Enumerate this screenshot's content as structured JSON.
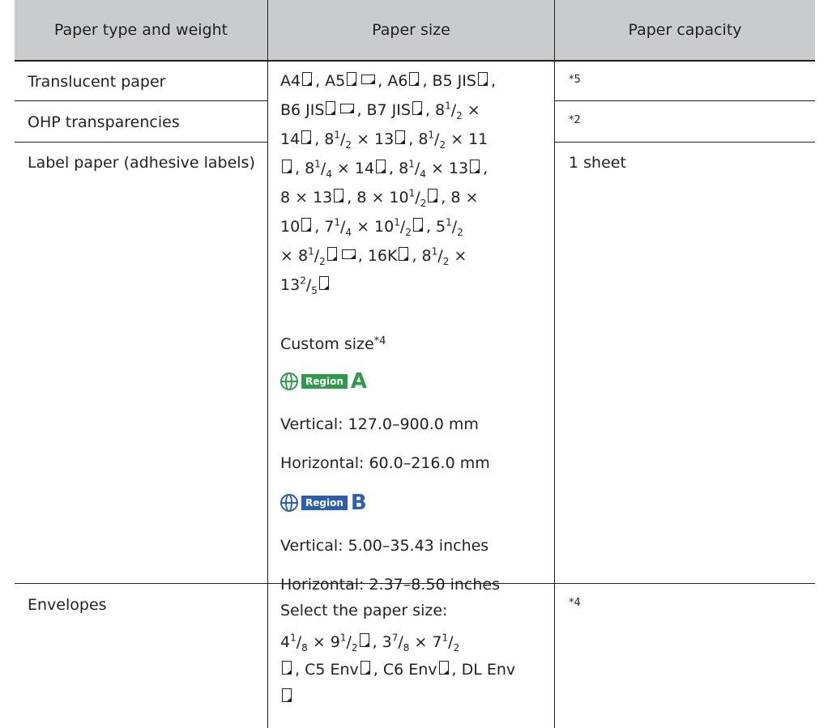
{
  "header": {
    "col1": "Paper type and weight",
    "col2": "Paper size",
    "col3": "Paper capacity"
  },
  "rows": [
    {
      "type": "Translucent paper",
      "capacity": "*5"
    },
    {
      "type": "OHP transparencies",
      "capacity": "*2"
    },
    {
      "type": "Label paper (adhesive labels)",
      "capacity": "1 sheet"
    },
    {
      "type": "Envelopes",
      "capacity": "*4"
    }
  ],
  "sizes": {
    "line1": "A4, A5, A6, B5 JIS,",
    "custom_label": "Custom size",
    "custom_note": "*4",
    "region_a_tag": "Region",
    "region_a_letter": "A",
    "region_a_vertical": "Vertical: 127.0–900.0 mm",
    "region_a_horizontal": "Horizontal: 60.0–216.0 mm",
    "region_b_tag": "Region",
    "region_b_letter": "B",
    "region_b_vertical": "Vertical: 5.00–35.43 inches",
    "region_b_horizontal": "Horizontal: 2.37–8.50 inches",
    "env_select": "Select the paper size:"
  },
  "colors": {
    "header_bg": "#c9cbcc",
    "region_a": "#2e9a4a",
    "region_b": "#2a5fb0",
    "rule": "#231f20"
  }
}
